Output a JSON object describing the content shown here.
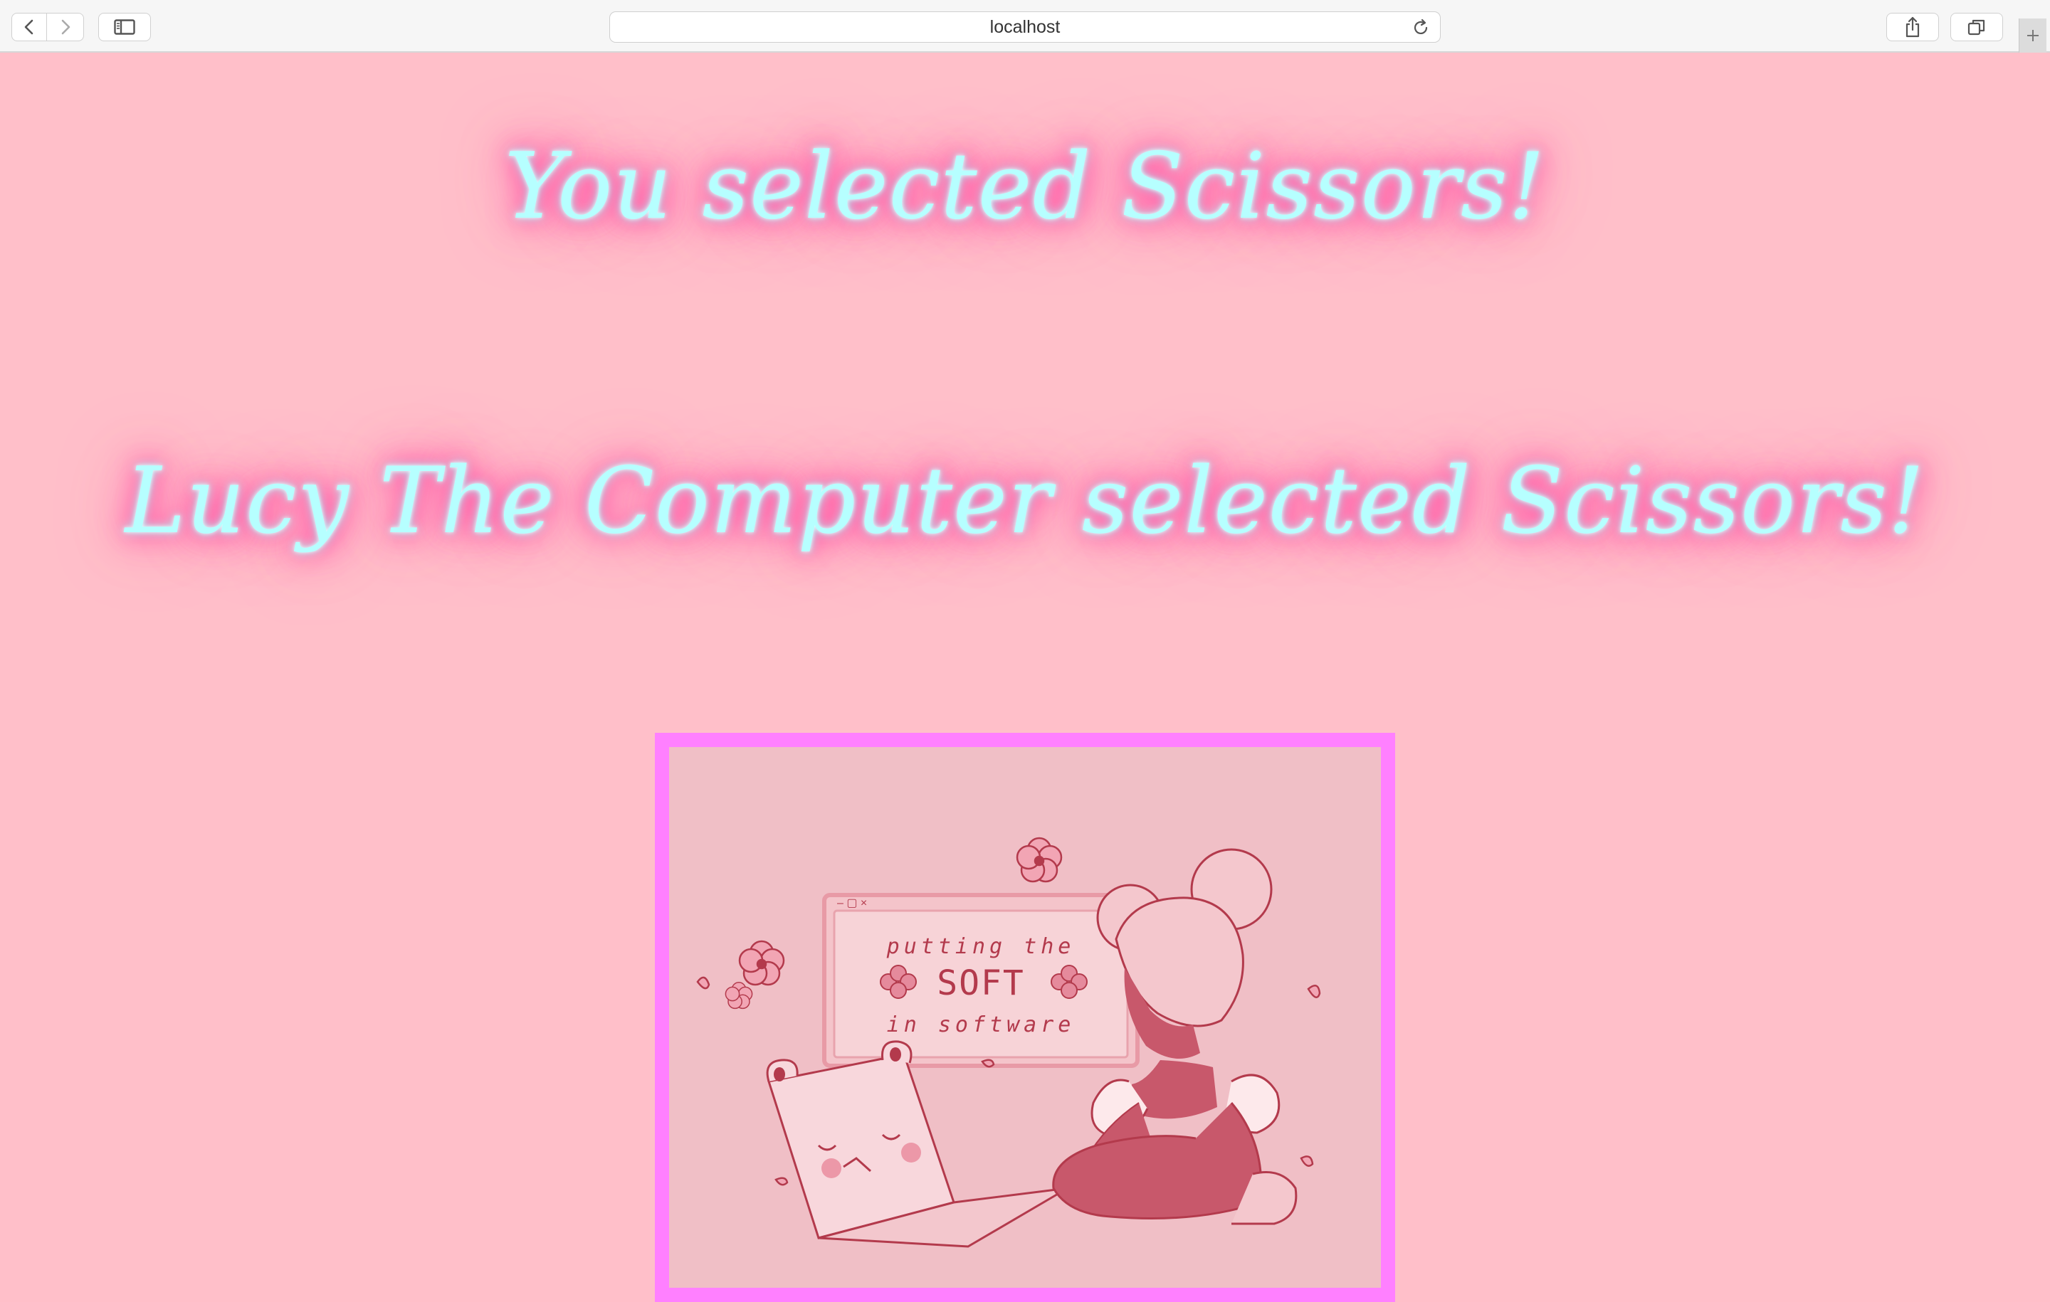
{
  "browser": {
    "url": "localhost",
    "icons": {
      "back": "chevron-left-icon",
      "forward": "chevron-right-icon",
      "sidebar": "sidebar-icon",
      "reload": "reload-icon",
      "share": "share-icon",
      "tabs": "tabs-overview-icon",
      "new_tab": "plus-icon"
    }
  },
  "result": {
    "player_choice_text": "You selected Scissors!",
    "computer_choice_text": "Lucy The Computer selected Scissors!"
  },
  "illustration": {
    "window_line1": "putting the",
    "window_line2": "SOFT",
    "window_line3": "in software"
  },
  "colors": {
    "page_background": "#ffbfc9",
    "headline_text": "#b6ffff",
    "headline_glow": "#ff4fa3",
    "image_border": "#ff80ff",
    "illustration_background": "#f0bfc6",
    "illustration_ink": "#b33a4c"
  }
}
